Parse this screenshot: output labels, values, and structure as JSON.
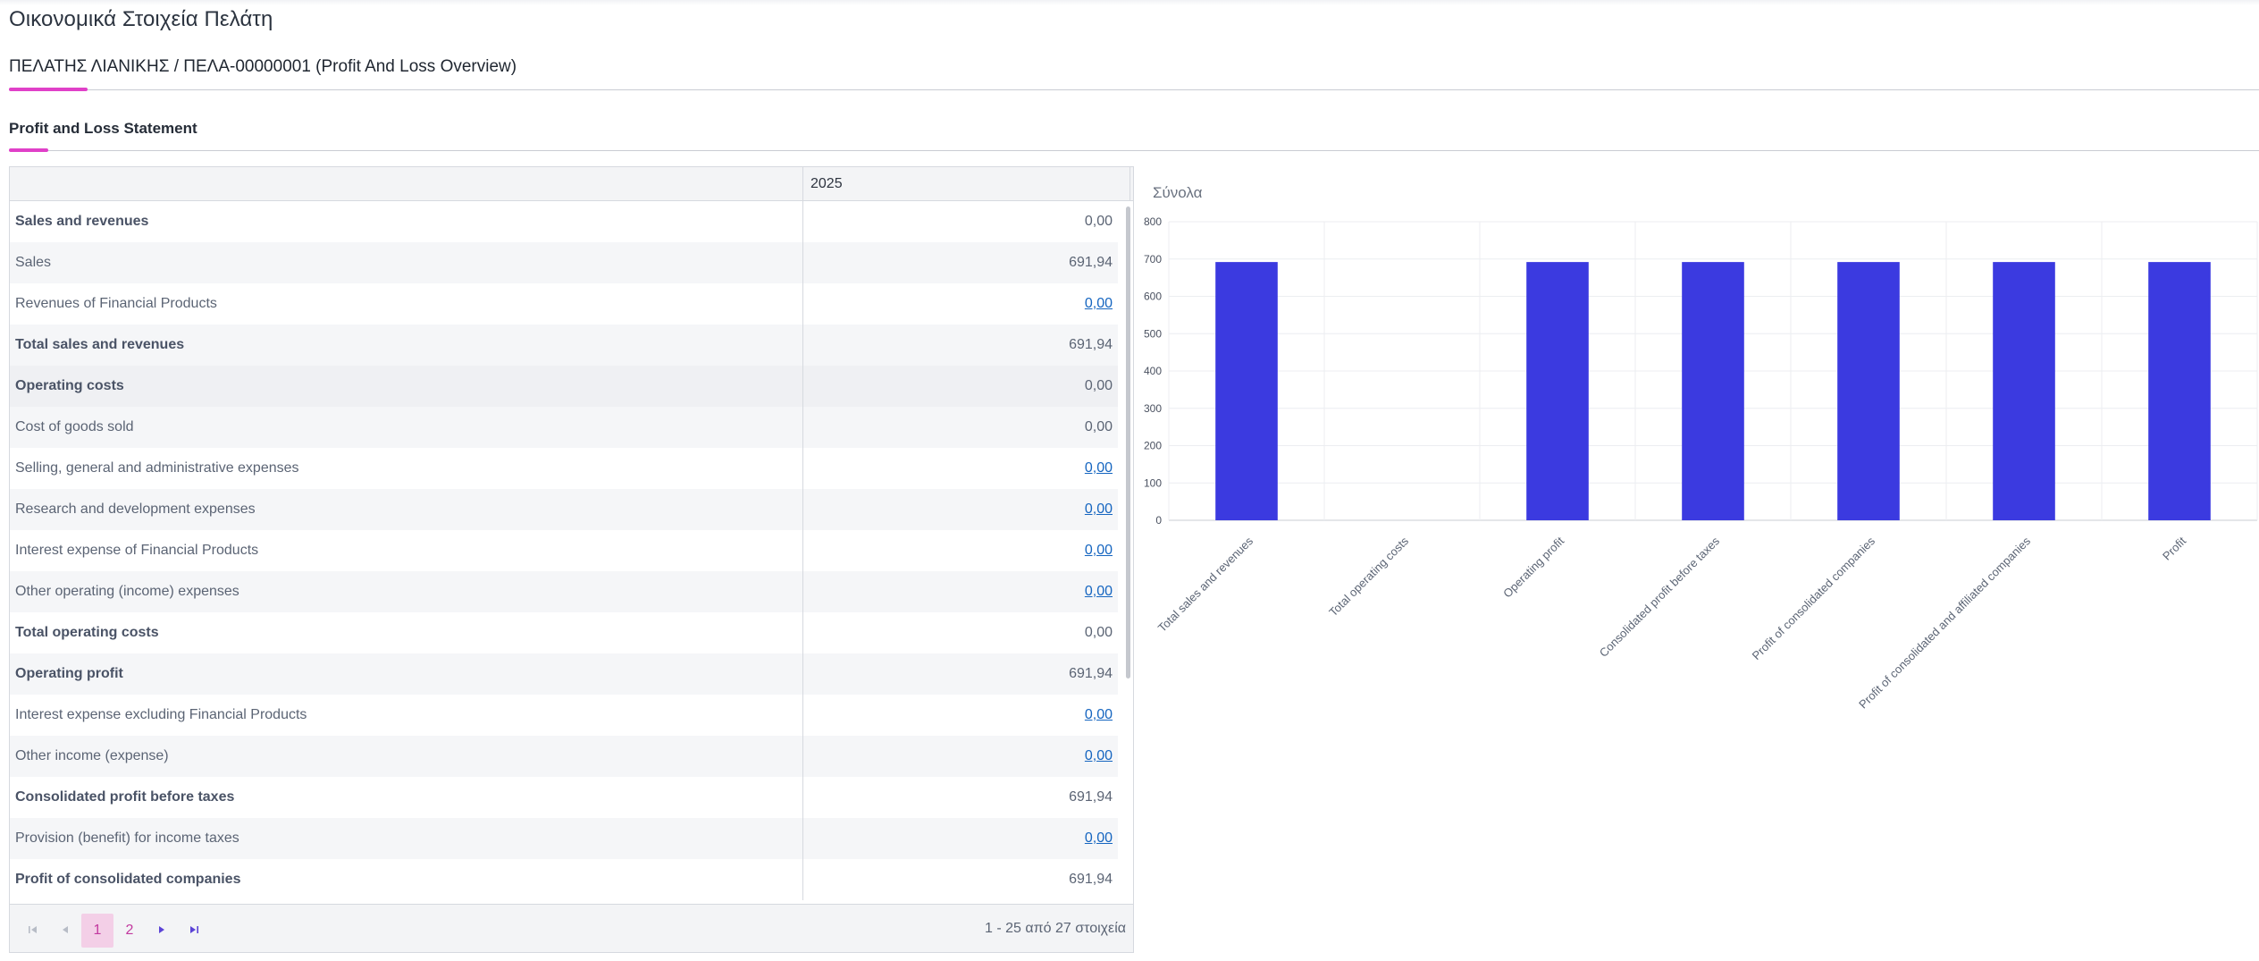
{
  "page": {
    "title": "Οικονομικά Στοιχεία Πελάτη",
    "breadcrumb": "ΠΕΛΑΤΗΣ ΛΙΑΝΙΚΗΣ / ΠΕΛΑ-00000001 (Profit And Loss Overview)",
    "section_title": "Profit and Loss Statement",
    "accent_color": "#e040c8"
  },
  "grid": {
    "columns": [
      "",
      "2025"
    ],
    "rows": [
      {
        "label": "Sales and revenues",
        "value": "0,00",
        "bold": true,
        "link": false
      },
      {
        "label": "Sales",
        "value": "691,94",
        "bold": false,
        "link": false
      },
      {
        "label": "Revenues of Financial Products",
        "value": "0,00",
        "bold": false,
        "link": true
      },
      {
        "label": "Total sales and revenues",
        "value": "691,94",
        "bold": true,
        "link": false
      },
      {
        "label": "Operating costs",
        "value": "0,00",
        "bold": true,
        "link": false
      },
      {
        "label": "Cost of goods sold",
        "value": "0,00",
        "bold": false,
        "link": false
      },
      {
        "label": "Selling, general and administrative expenses",
        "value": "0,00",
        "bold": false,
        "link": true
      },
      {
        "label": "Research and development expenses",
        "value": "0,00",
        "bold": false,
        "link": true
      },
      {
        "label": "Interest expense of Financial Products",
        "value": "0,00",
        "bold": false,
        "link": true
      },
      {
        "label": "Other operating (income) expenses",
        "value": "0,00",
        "bold": false,
        "link": true
      },
      {
        "label": "Total operating costs",
        "value": "0,00",
        "bold": true,
        "link": false
      },
      {
        "label": "Operating profit",
        "value": "691,94",
        "bold": true,
        "link": false
      },
      {
        "label": "Interest expense excluding Financial Products",
        "value": "0,00",
        "bold": false,
        "link": true
      },
      {
        "label": "Other income (expense)",
        "value": "0,00",
        "bold": false,
        "link": true
      },
      {
        "label": "Consolidated profit before taxes",
        "value": "691,94",
        "bold": true,
        "link": false
      },
      {
        "label": "Provision (benefit) for income taxes",
        "value": "0,00",
        "bold": false,
        "link": true
      },
      {
        "label": "Profit of consolidated companies",
        "value": "691,94",
        "bold": true,
        "link": false
      }
    ]
  },
  "pager": {
    "pages": [
      "1",
      "2"
    ],
    "current_page": "1",
    "first_icon": "first-page-icon",
    "prev_icon": "prev-page-icon",
    "next_icon": "next-page-icon",
    "last_icon": "last-page-icon",
    "info": "1 - 25 από 27 στοιχεία"
  },
  "chart_data": {
    "type": "bar",
    "title": "Σύνολα",
    "categories": [
      "Total sales and revenues",
      "Total operating costs",
      "Operating profit",
      "Consolidated profit before taxes",
      "Profit of consolidated companies",
      "Profit of consolidated and affiliated companies",
      "Profit"
    ],
    "values": [
      691.94,
      0,
      691.94,
      691.94,
      691.94,
      691.94,
      691.94
    ],
    "yticks": [
      0,
      100,
      200,
      300,
      400,
      500,
      600,
      700,
      800
    ],
    "ylim": [
      0,
      800
    ],
    "xlabel": "",
    "ylabel": "",
    "grid": true,
    "bar_color": "#3b3ae0"
  }
}
